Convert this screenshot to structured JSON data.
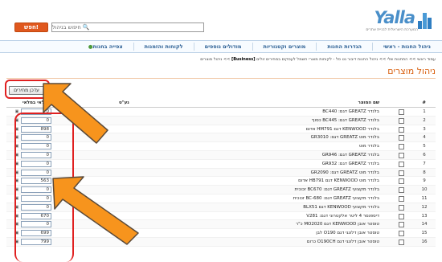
{
  "header": {
    "search_button": "חפש!",
    "search_placeholder": "חיפוש בניהול",
    "logo_text": "Yalla",
    "logo_sub": "המערכת הישראלית לבניית אתרים"
  },
  "nav": [
    "ניהול החנות - ראשי",
    "הגדרות החנות",
    "מוצרים וקטגוריות",
    "מודולים נוספים",
    "לקוחות והזמנות",
    "צפייה בחנות"
  ],
  "breadcrumb": {
    "prefix": "עמוד ראשי  >>  התחנות שלי  >>  ניהול החנות דיבור נט סל - לקוחות מוצרי חשמל לעסקים במחירים זולים",
    "bold": "[Business]",
    "suffix": ">>  ניהול מוצרים"
  },
  "page_title": "ניהול מוצרים",
  "update_button": "עדכן מחירים",
  "table": {
    "headers": {
      "num": "#",
      "name": "שם המוצר",
      "vat": "נע\"ט",
      "qty": "מלאי במלאי"
    },
    "rows": [
      {
        "num": "1",
        "name": "בלנדר GREATZ דגם: BC440",
        "qty": "0"
      },
      {
        "num": "2",
        "name": "בלנדר GREATZ דגם: BC445 כסוף",
        "qty": "0"
      },
      {
        "num": "3",
        "name": "בלנדר KENWOOD דגם HM791 אדום",
        "qty": "898"
      },
      {
        "num": "4",
        "name": "בלנדר מוט GREATZ דגם: GR3010",
        "qty": "0"
      },
      {
        "num": "5",
        "name": "בלנדר מוט",
        "qty": "0"
      },
      {
        "num": "6",
        "name": "בלנדר GREATZ דגם: GR946",
        "qty": "0"
      },
      {
        "num": "7",
        "name": "בלנדר GREATZ דגם: GR932",
        "qty": "0"
      },
      {
        "num": "8",
        "name": "בלנדר מוט GREATZ דגם: GR2090",
        "qty": "0"
      },
      {
        "num": "9",
        "name": "בלנדר מוט KENWOOD דגם HB791 אדום",
        "qty": "563"
      },
      {
        "num": "10",
        "name": "בלנדר מקצועי GREATZ דגם: BC670 זכוכית",
        "qty": "0"
      },
      {
        "num": "11",
        "name": "בלנדר מקצועי GREATZ דגם: BC-680 זכוכית",
        "qty": "0"
      },
      {
        "num": "12",
        "name": "בלנדר מקצועי KENWOOD דגם BLX51",
        "qty": "0"
      },
      {
        "num": "13",
        "name": "דיספנסר 4 ליטר אלקטרוני דגם: V281",
        "qty": "670"
      },
      {
        "num": "14",
        "name": "טוסטר אובן KENWOOD דגם MO2020 כ\"ר",
        "qty": "0"
      },
      {
        "num": "15",
        "name": "טוסטר אובן דלונגי דגם O190 לבן",
        "qty": "699"
      },
      {
        "num": "16",
        "name": "טוסטר אובן דלונגי דגם O190CH כרום",
        "qty": "799"
      }
    ]
  },
  "colors": {
    "accent": "#e0581e",
    "title": "#d9600f",
    "nav_text": "#2b5f94",
    "highlight": "#e02020",
    "arrow": "#f7941d"
  },
  "icons": [
    "search-icon",
    "globe-icon",
    "edit-icon",
    "arrow-annotation"
  ]
}
